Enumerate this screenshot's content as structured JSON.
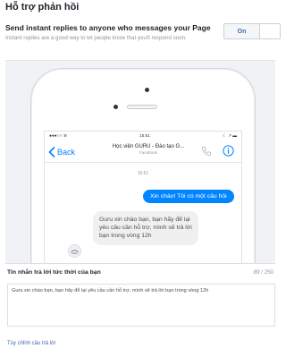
{
  "page": {
    "title": "Hỗ trợ phản hồi"
  },
  "setting": {
    "heading": "Send instant replies to anyone who messages your Page",
    "description": "Instant replies are a good way to let people know that you'll respond soon.",
    "toggle_on_label": "On"
  },
  "phone": {
    "status_bar": {
      "carrier": "●●●○○ ≋",
      "time": "15:51",
      "icons": "☾ ↗ ▬"
    },
    "nav": {
      "back_label": "Back",
      "title": "Học viện GURU - Đào tạo G...",
      "subtitle": "Facebook",
      "icons": [
        "phone-icon",
        "info-icon"
      ]
    },
    "chat": {
      "timestamp": "15:51",
      "outgoing_message": "Xin chào! Tôi có một câu hỏi",
      "incoming_message": "Guru xin chào bạn, bạn  hãy để lại yêu cầu cần hỗ trợ, mình sẽ trả lời bạn trong vòng 12h"
    }
  },
  "reply": {
    "label": "Tin nhắn trả lời tức thời của bạn",
    "char_count": "89 / 250",
    "text": "Guru xin chào bạn, bạn  hãy để lại yêu cầu cần hỗ trợ, mình sẽ trả lời bạn trong vòng 12h",
    "customize_link": "Tùy chỉnh câu trả lời"
  },
  "colors": {
    "accent": "#4267b2",
    "messenger_blue": "#0084ff",
    "incoming_bubble": "#f1f0f0",
    "panel_bg": "#f0f2f5"
  }
}
